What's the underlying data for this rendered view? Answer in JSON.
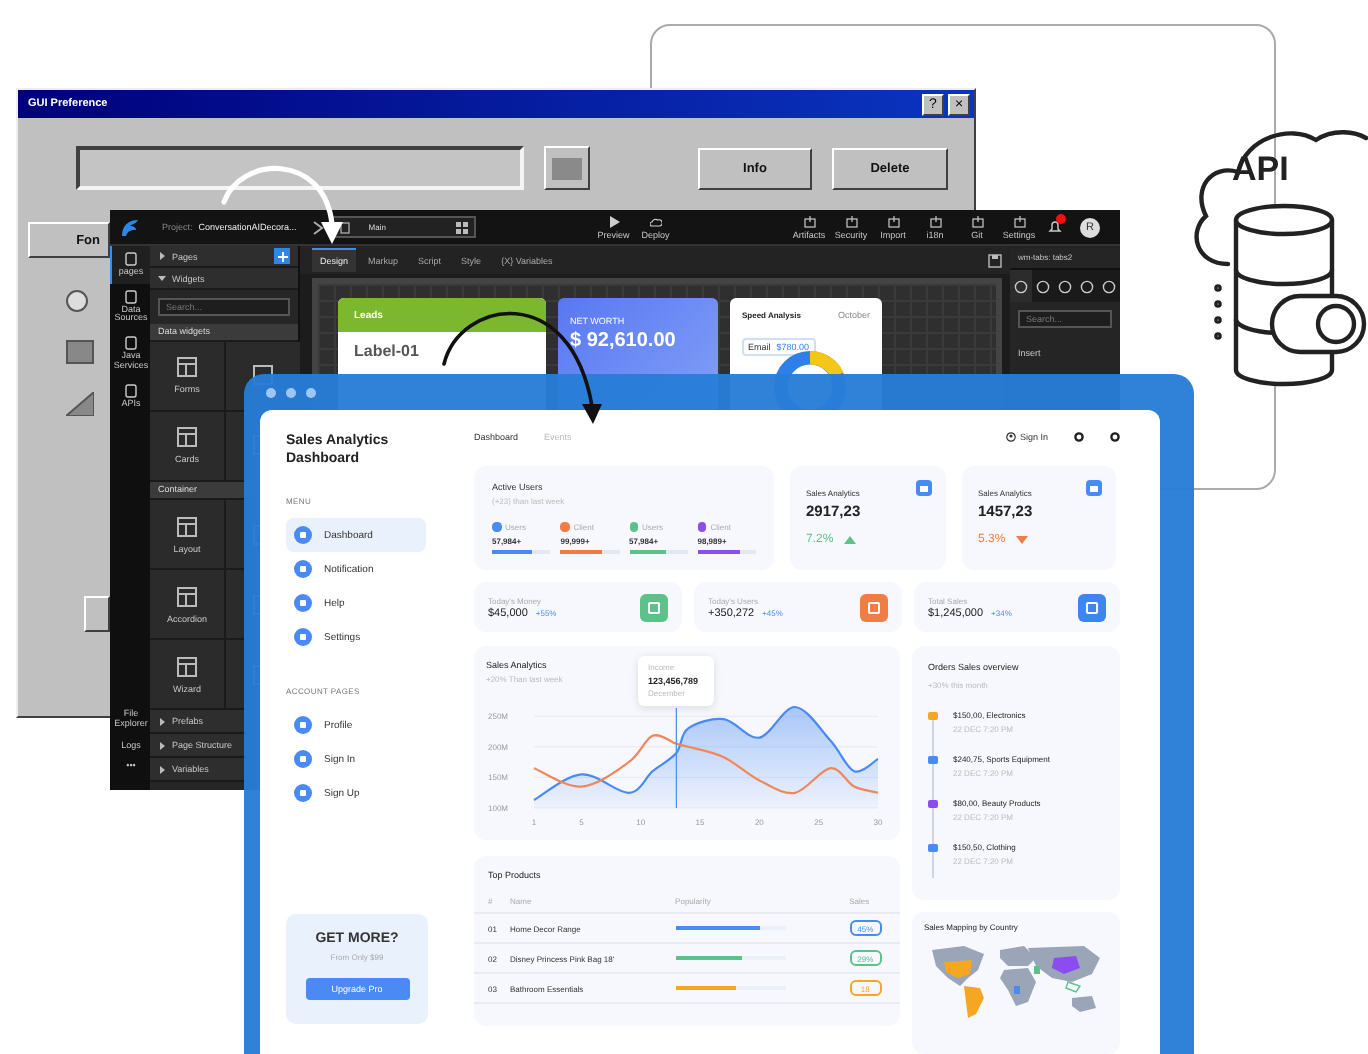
{
  "api_badge": {
    "label": "API"
  },
  "gui_window": {
    "title": "GUI Preference",
    "title_buttons": [
      "?",
      "×"
    ],
    "buttons": [
      "Info",
      "Delete"
    ],
    "side_button": "Fon"
  },
  "ide_window": {
    "project_label": "Project:",
    "project_name": "ConversationAIDecora...",
    "page_tab": "Main",
    "actions": [
      "Preview",
      "Deploy"
    ],
    "tools": [
      "Artifacts",
      "Security",
      "Import",
      "i18n",
      "Git",
      "Settings"
    ],
    "avatar": "R",
    "rail": [
      {
        "label": "pages",
        "selected": true
      },
      {
        "label": "Data Sources",
        "selected": false
      },
      {
        "label": "Java Services",
        "selected": false
      },
      {
        "label": "APIs",
        "selected": false
      }
    ],
    "rail_bottom": [
      "File Explorer",
      "Logs",
      "•••"
    ],
    "panel": {
      "pages": "Pages",
      "widgets": "Widgets",
      "search_placeholder": "Search...",
      "groups": [
        {
          "title": "Data widgets",
          "tiles": [
            "Forms",
            "Cards"
          ]
        },
        {
          "title": "Container",
          "tiles": [
            "Layout",
            "Accordion",
            "Wizard"
          ]
        }
      ],
      "sections": [
        "Prefabs",
        "Page Structure",
        "Variables"
      ]
    },
    "editor_tabs": [
      {
        "label": "Design",
        "selected": true
      },
      {
        "label": "Markup",
        "selected": false
      },
      {
        "label": "Script",
        "selected": false
      },
      {
        "label": "Style",
        "selected": false
      },
      {
        "label": "{X} Variables",
        "selected": false
      }
    ],
    "canvas_cards": [
      {
        "kind": "leads",
        "title": "Leads",
        "value": "Label-01"
      },
      {
        "kind": "net_worth",
        "title": "NET WORTH",
        "value": "$ 92,610.00"
      },
      {
        "kind": "donut",
        "title": "Speed Analysis",
        "filter": "October",
        "legend": "Email",
        "legend_value": "$780.00"
      }
    ],
    "properties": {
      "title": "wm-tabs: tabs2",
      "search_placeholder": "Search...",
      "section": "Insert"
    }
  },
  "dashboard": {
    "title": "Sales Analytics Dashboard",
    "menu_heading": "MENU",
    "menu": [
      {
        "label": "Dashboard",
        "selected": true
      },
      {
        "label": "Notification",
        "selected": false
      },
      {
        "label": "Help",
        "selected": false
      },
      {
        "label": "Settings",
        "selected": false
      }
    ],
    "account_heading": "ACCOUNT PAGES",
    "account": [
      {
        "label": "Profile"
      },
      {
        "label": "Sign In"
      },
      {
        "label": "Sign Up"
      }
    ],
    "promo": {
      "title": "GET MORE?",
      "subtitle": "From Only $99",
      "button": "Upgrade Pro"
    },
    "tabs": [
      {
        "label": "Dashboard",
        "selected": true
      },
      {
        "label": "Events",
        "selected": false
      }
    ],
    "sign_in": "Sign In",
    "active_users": {
      "title": "Active Users",
      "subtitle": "(+23) than last week",
      "stats": [
        {
          "label": "Users",
          "value": "57,984+",
          "color": "#4a8af4",
          "level": 0.7
        },
        {
          "label": "Client",
          "value": "99,999+",
          "color": "#f07d45",
          "level": 0.72
        },
        {
          "label": "Users",
          "value": "57,984+",
          "color": "#5cc28a",
          "level": 0.62
        },
        {
          "label": "Client",
          "value": "98,989+",
          "color": "#8b4cf0",
          "level": 0.72
        }
      ]
    },
    "sales_cards": [
      {
        "title": "Sales Analytics",
        "value": "2917,23",
        "change": "7.2%",
        "kind": "up"
      },
      {
        "title": "Sales Analytics",
        "value": "1457,23",
        "change": "5.3%",
        "kind": "down"
      }
    ],
    "stat_cards": [
      {
        "title": "Today's Money",
        "value": "$45,000",
        "change": "+55%",
        "color": "#5cc28a"
      },
      {
        "title": "Today's Users",
        "value": "+350,272",
        "change": "+45%",
        "color": "#f07d45"
      },
      {
        "title": "Total Sales",
        "value": "$1,245,000",
        "change": "+34%",
        "color": "#3d86f0"
      }
    ],
    "sales_chart": {
      "title": "Sales Analytics",
      "subtitle": "+20% Than last week",
      "tooltip": {
        "label": "Income",
        "value": "123,456,789",
        "period": "December"
      },
      "chart_data": {
        "type": "area",
        "x": [
          1,
          5,
          9,
          11,
          13,
          14,
          17,
          20,
          23,
          26,
          28,
          30
        ],
        "series": [
          {
            "color": "#4a8af4",
            "values": [
              113,
              155,
              125,
              160,
              190,
              230,
              245,
              215,
              265,
              210,
              160,
              180
            ]
          },
          {
            "color": "#f0875a",
            "type": "line",
            "values": [
              165,
              135,
              175,
              218,
              205,
              200,
              183,
              145,
              125,
              165,
              135,
              125
            ]
          }
        ],
        "ref_lines": [
          {
            "axis": "x",
            "value": 13,
            "color": "#4a8af4"
          }
        ],
        "grid": true,
        "xlim": [
          1,
          30
        ],
        "ylim": [
          100,
          270
        ],
        "xticks": [
          1,
          5,
          10,
          15,
          20,
          25,
          30
        ],
        "yticks": [
          {
            "value": 100,
            "label": "100M"
          },
          {
            "value": 150,
            "label": "150M"
          },
          {
            "value": 200,
            "label": "200M"
          },
          {
            "value": 250,
            "label": "250M"
          }
        ]
      }
    },
    "orders": {
      "title": "Orders Sales overview",
      "subtitle": "+30% this month",
      "items": [
        {
          "title": "$150,00, Electronics",
          "time": "22 DEC 7:20 PM",
          "color": "#f5a623"
        },
        {
          "title": "$240,75, Sports Equipment",
          "time": "22 DEC 7:20 PM",
          "color": "#4a8af4"
        },
        {
          "title": "$80,00, Beauty Products",
          "time": "22 DEC 7:20 PM",
          "color": "#8b4cf0"
        },
        {
          "title": "$150,50, Clothing",
          "time": "22 DEC 7:20 PM",
          "color": "#4a8af4"
        }
      ]
    },
    "products": {
      "title": "Top Products",
      "columns": [
        "#",
        "Name",
        "Popularity",
        "Sales"
      ],
      "rows": [
        {
          "rank": "01",
          "name": "Home Decor Range",
          "level": 0.78,
          "sales": "45%",
          "color": "#4a8af4"
        },
        {
          "rank": "02",
          "name": "Disney Princess Pink Bag 18'",
          "level": 0.6,
          "sales": "29%",
          "color": "#5cc28a"
        },
        {
          "rank": "03",
          "name": "Bathroom Essentials",
          "level": 0.55,
          "sales": "18",
          "color": "#f5a623"
        }
      ]
    },
    "map": {
      "title": "Sales Mapping by Country"
    }
  }
}
